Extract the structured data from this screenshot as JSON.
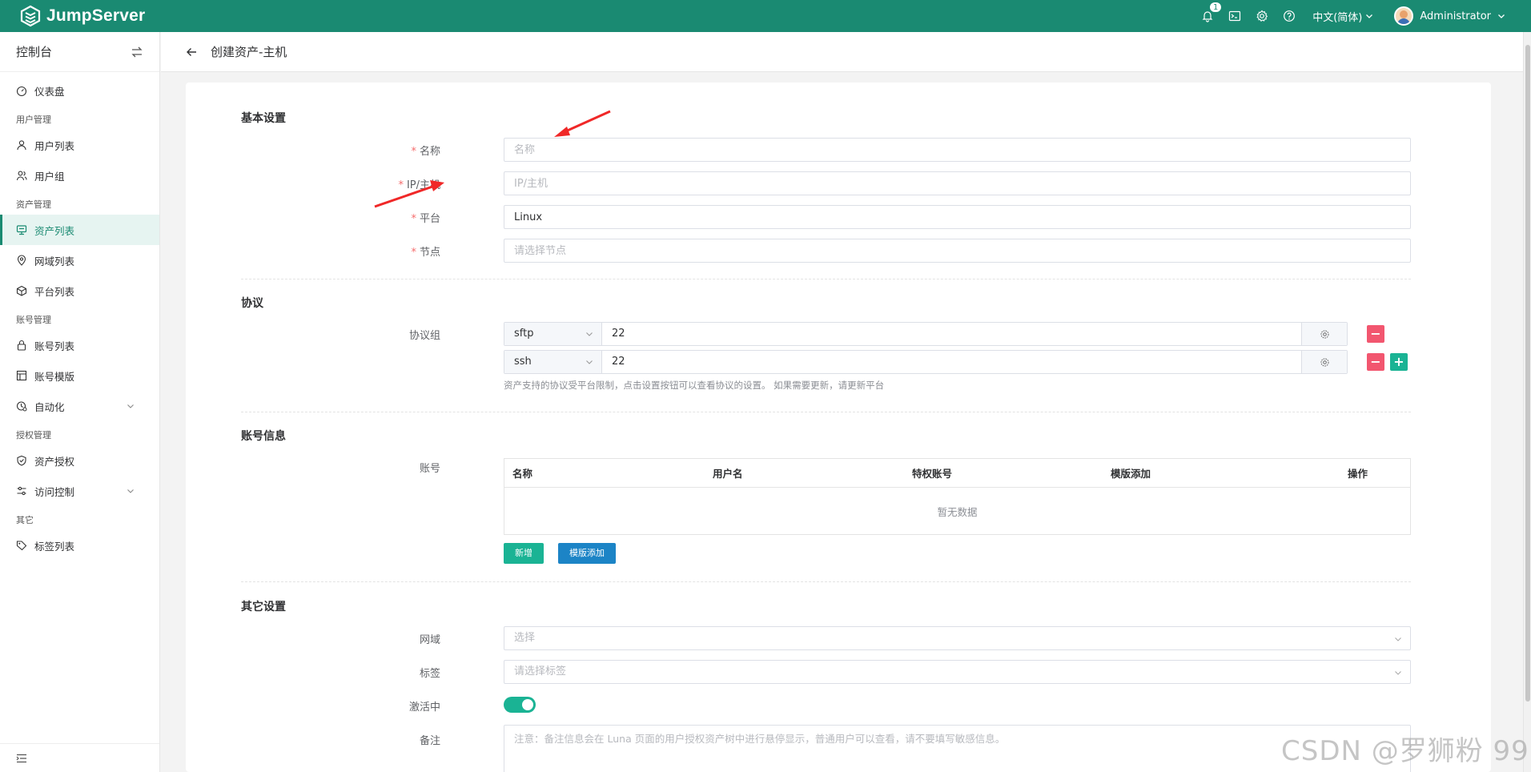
{
  "app": {
    "name": "JumpServer"
  },
  "topbar": {
    "notification_count": "1",
    "language": "中文(简体)",
    "user_name": "Administrator"
  },
  "sidebar": {
    "title": "控制台",
    "groups": [
      {
        "section": "",
        "items": [
          {
            "label": "仪表盘",
            "icon": "dashboard-icon"
          }
        ]
      },
      {
        "section": "用户管理",
        "items": [
          {
            "label": "用户列表",
            "icon": "user-icon"
          },
          {
            "label": "用户组",
            "icon": "user-group-icon"
          }
        ]
      },
      {
        "section": "资产管理",
        "items": [
          {
            "label": "资产列表",
            "icon": "asset-icon",
            "active": true
          },
          {
            "label": "网域列表",
            "icon": "location-icon"
          },
          {
            "label": "平台列表",
            "icon": "cube-icon"
          }
        ]
      },
      {
        "section": "账号管理",
        "items": [
          {
            "label": "账号列表",
            "icon": "lock-icon"
          },
          {
            "label": "账号模版",
            "icon": "template-icon"
          },
          {
            "label": "自动化",
            "icon": "automation-icon",
            "expandable": true
          }
        ]
      },
      {
        "section": "授权管理",
        "items": [
          {
            "label": "资产授权",
            "icon": "shield-icon"
          },
          {
            "label": "访问控制",
            "icon": "filter-icon",
            "expandable": true
          }
        ]
      },
      {
        "section": "其它",
        "items": [
          {
            "label": "标签列表",
            "icon": "tag-icon"
          }
        ]
      }
    ]
  },
  "page": {
    "title": "创建资产-主机"
  },
  "form": {
    "basic": {
      "title": "基本设置",
      "name": {
        "label": "名称",
        "placeholder": "名称"
      },
      "address": {
        "label": "IP/主机",
        "placeholder": "IP/主机"
      },
      "platform": {
        "label": "平台",
        "value": "Linux"
      },
      "node": {
        "label": "节点",
        "placeholder": "请选择节点"
      }
    },
    "protocols": {
      "title": "协议",
      "label": "协议组",
      "rows": [
        {
          "protocol": "sftp",
          "port": "22"
        },
        {
          "protocol": "ssh",
          "port": "22"
        }
      ],
      "hint": "资产支持的协议受平台限制，点击设置按钮可以查看协议的设置。 如果需要更新，请更新平台"
    },
    "accounts": {
      "title": "账号信息",
      "label": "账号",
      "columns": [
        "名称",
        "用户名",
        "特权账号",
        "模版添加",
        "操作"
      ],
      "empty": "暂无数据",
      "add_button": "新增",
      "template_button": "模版添加"
    },
    "other": {
      "title": "其它设置",
      "domain": {
        "label": "网域",
        "placeholder": "选择"
      },
      "labels": {
        "label": "标签",
        "placeholder": "请选择标签"
      },
      "active": {
        "label": "激活中",
        "value": true
      },
      "comment": {
        "label": "备注",
        "placeholder": "注意：备注信息会在 Luna 页面的用户授权资产树中进行悬停显示，普通用户可以查看，请不要填写敏感信息。"
      }
    }
  },
  "watermark": "CSDN @罗狮粉 99",
  "colors": {
    "brand": "#1a8a72",
    "danger": "#f2566f",
    "success": "#1ab394",
    "primary": "#1c84c6",
    "annotation_arrow": "#f02828"
  }
}
